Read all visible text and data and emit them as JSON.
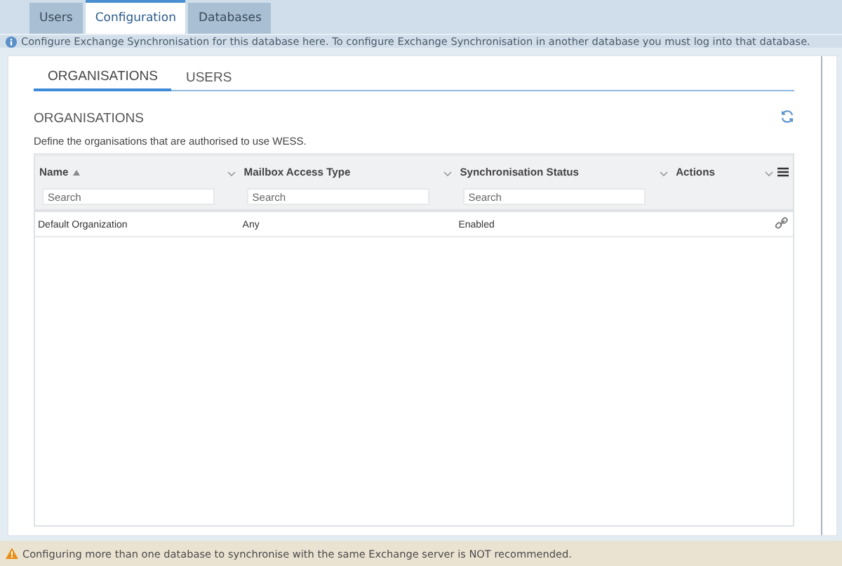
{
  "top_tabs": [
    {
      "label": "Users",
      "selected": false
    },
    {
      "label": "Configuration",
      "selected": true
    },
    {
      "label": "Databases",
      "selected": false
    }
  ],
  "info_message": "Configure Exchange Synchronisation for this database here. To configure Exchange Synchronisation in another database you must log into that database.",
  "panel_tabs": [
    {
      "label": "ORGANISATIONS",
      "selected": true
    },
    {
      "label": "USERS",
      "selected": false
    }
  ],
  "section_title": "ORGANISATIONS",
  "section_description": "Define the organisations that are authorised to use WESS.",
  "table": {
    "columns": [
      {
        "label": "Name",
        "sorted": true,
        "placeholder": "Search"
      },
      {
        "label": "Mailbox Access Type",
        "sorted": false,
        "placeholder": "Search"
      },
      {
        "label": "Synchronisation Status",
        "sorted": false,
        "placeholder": "Search"
      },
      {
        "label": "Actions",
        "sorted": false
      }
    ],
    "rows": [
      {
        "cells": [
          "Default Organization",
          "Any",
          "Enabled"
        ]
      }
    ]
  },
  "warning_message": "Configuring more than one database to synchronise with the same Exchange server is NOT recommended."
}
